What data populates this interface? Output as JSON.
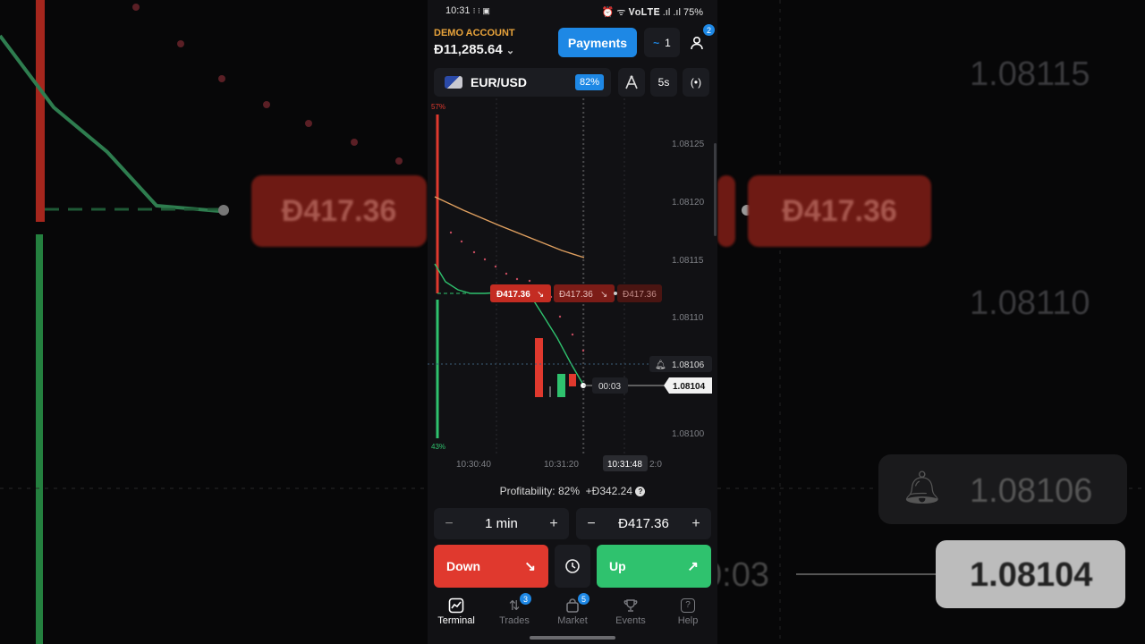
{
  "status": {
    "time": "10:31",
    "indicators": "⁝ ⁝ ▣",
    "right": "⏰ ᯤ 𝐕𝐨𝐋𝐓𝐄 .ıl .ıl 75%"
  },
  "account": {
    "label": "DEMO ACCOUNT",
    "balance": "Đ11,285.64"
  },
  "header": {
    "payments_label": "Payments",
    "signals_count": "1",
    "notifications_badge": "2"
  },
  "pair": {
    "name": "EUR/USD",
    "payout": "82%",
    "timeframe": "5s"
  },
  "chart_data": {
    "type": "line",
    "ylim": [
      1.081,
      1.08127
    ],
    "y_ticks": [
      "1.08125",
      "1.08120",
      "1.08115",
      "1.08110",
      "1.08100"
    ],
    "x_ticks": [
      "10:30:40",
      "10:31:20",
      "2:0"
    ],
    "current_time_label": "10:31:48",
    "current_price": "1.08104",
    "alert_price": "1.08106",
    "countdown": "00:03",
    "sentiment_up": "57%",
    "sentiment_down": "43%",
    "open_trades": [
      {
        "amount": "Đ417.36",
        "direction": "down"
      },
      {
        "amount": "Đ417.36",
        "direction": "down"
      },
      {
        "amount": "Đ417.36",
        "direction": "down"
      }
    ],
    "series": [
      {
        "price": [
          1.08114,
          1.08113,
          1.08112,
          1.08112,
          1.08111,
          1.0811,
          1.08106,
          1.08104
        ]
      },
      {
        "moving_average": [
          1.0812,
          1.08118,
          1.08117,
          1.08116,
          1.08115
        ]
      }
    ]
  },
  "profitability": {
    "label": "Profitability: 82%",
    "amount": "+Đ342.24"
  },
  "controls": {
    "duration": "1 min",
    "investment": "Đ417.36",
    "minus": "−",
    "plus": "+"
  },
  "actions": {
    "down_label": "Down",
    "up_label": "Up"
  },
  "nav": [
    {
      "label": "Terminal",
      "badge": ""
    },
    {
      "label": "Trades",
      "badge": "3"
    },
    {
      "label": "Market",
      "badge": "5"
    },
    {
      "label": "Events",
      "badge": ""
    },
    {
      "label": "Help",
      "badge": ""
    }
  ],
  "colors": {
    "accent": "#1e88e5",
    "down": "#e0392e",
    "up": "#2fc26e",
    "demo": "#e8a33b"
  }
}
